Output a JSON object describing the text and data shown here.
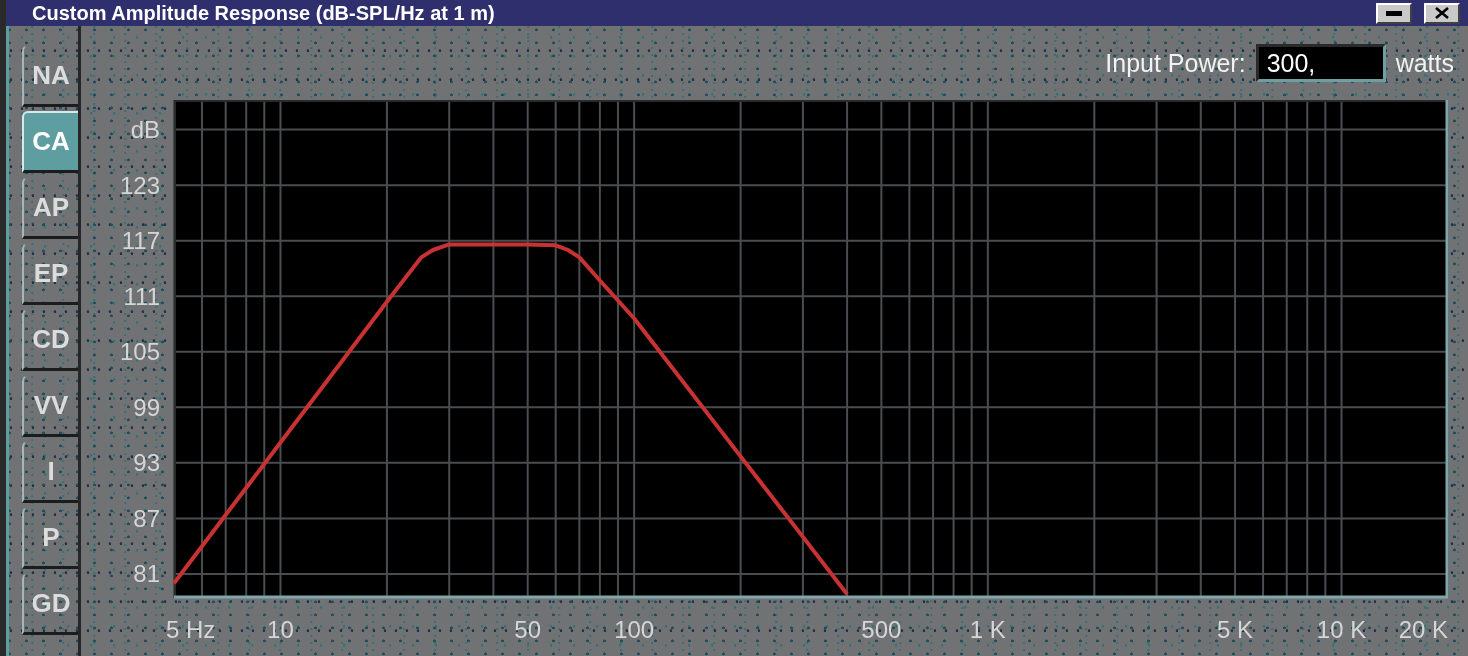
{
  "window": {
    "title": "Custom Amplitude Response (dB-SPL/Hz at 1 m)"
  },
  "tabs": [
    {
      "label": "NA",
      "selected": false
    },
    {
      "label": "CA",
      "selected": true
    },
    {
      "label": "AP",
      "selected": false
    },
    {
      "label": "EP",
      "selected": false
    },
    {
      "label": "CD",
      "selected": false
    },
    {
      "label": "VV",
      "selected": false
    },
    {
      "label": "I",
      "selected": false
    },
    {
      "label": "P",
      "selected": false
    },
    {
      "label": "GD",
      "selected": false
    }
  ],
  "input_power": {
    "label": "Input Power:",
    "value": "300,",
    "unit": "watts"
  },
  "chart": {
    "chart_data": {
      "type": "line",
      "log": "x",
      "grid": true,
      "x": [
        5,
        10,
        20,
        25,
        27,
        30,
        40,
        50,
        60,
        65,
        70,
        80,
        100,
        200,
        300,
        400
      ],
      "series": [
        {
          "color": "#c83232",
          "values": [
            80.0,
            95.2,
            110.4,
            115.2,
            116.0,
            116.6,
            116.6,
            116.6,
            116.5,
            116.0,
            115.2,
            112.7,
            108.6,
            93.7,
            85.0,
            78.8
          ]
        }
      ],
      "xlim": [
        5,
        20000
      ],
      "ylim": [
        78.4,
        132.2
      ],
      "xticks": [
        {
          "value": 5,
          "label": "5 Hz"
        },
        {
          "value": 10,
          "label": "10"
        },
        {
          "value": 50,
          "label": "50"
        },
        {
          "value": 100,
          "label": "100"
        },
        {
          "value": 500,
          "label": "500"
        },
        {
          "value": 1000,
          "label": "1 K"
        },
        {
          "value": 5000,
          "label": "5 K"
        },
        {
          "value": 10000,
          "label": "10 K"
        },
        {
          "value": 20000,
          "label": "20 K"
        }
      ],
      "yticks": [
        {
          "value": 129,
          "label": "dB"
        },
        123,
        117,
        111,
        105,
        99,
        93,
        87,
        81
      ]
    }
  }
}
